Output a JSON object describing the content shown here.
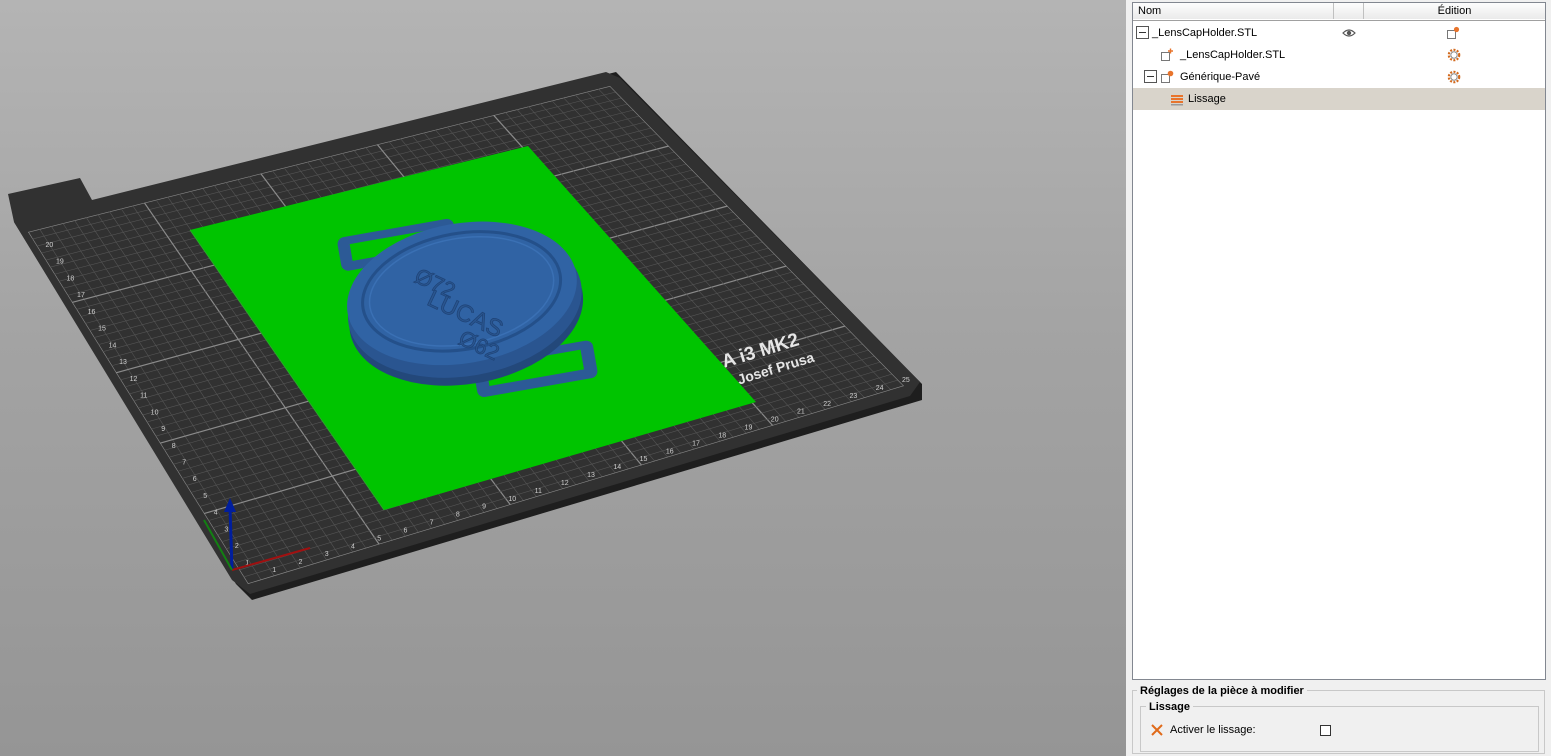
{
  "tree": {
    "header": {
      "name_col": "Nom",
      "edit_col": "Édition"
    },
    "rows": [
      {
        "label": "_LensCapHolder.STL"
      },
      {
        "label": "_LensCapHolder.STL"
      },
      {
        "label": "Générique-Pavé"
      },
      {
        "label": "Lissage"
      }
    ]
  },
  "settings": {
    "title": "Réglages de la pièce à modifier",
    "group_title": "Lissage",
    "option_label": "Activer le lissage:",
    "option_checked": false
  },
  "bed": {
    "brand_line1": "A i3  MK2",
    "brand_line2": "y Josef Prusa",
    "model_text_1": "Ø72",
    "model_text_2": "LUCAS",
    "model_text_3": "Ø62",
    "x_ticks": [
      "1",
      "2",
      "3",
      "4",
      "5",
      "6",
      "7",
      "8",
      "9",
      "10",
      "11",
      "12",
      "13",
      "14",
      "15",
      "16",
      "17",
      "18",
      "19",
      "20",
      "21",
      "22",
      "23",
      "24",
      "25"
    ],
    "y_ticks": [
      "1",
      "2",
      "3",
      "4",
      "5",
      "6",
      "7",
      "8",
      "9",
      "10",
      "11",
      "12",
      "13",
      "14",
      "15",
      "16",
      "17",
      "18",
      "19",
      "20"
    ]
  },
  "colors": {
    "bed": "#2e2e2e",
    "modifier": "#00c400",
    "part": "#3063a4",
    "selection": "#d9d4cb",
    "accent_orange": "#e8742c"
  },
  "icons": {
    "visibility": "eye-icon",
    "edit": "gear-icon",
    "add_part": "add-part-icon",
    "modifier": "modifier-icon",
    "ironing": "ironing-icon",
    "remove": "remove-x-icon"
  }
}
